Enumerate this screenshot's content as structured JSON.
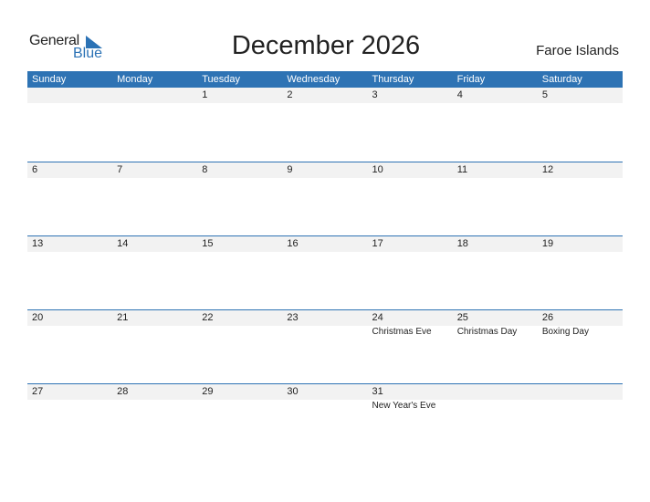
{
  "logo": {
    "general": "General",
    "blue": "Blue"
  },
  "title": "December 2026",
  "country": "Faroe Islands",
  "colors": {
    "accent": "#2e73b4",
    "band": "#f2f2f2"
  },
  "weekdays": [
    "Sunday",
    "Monday",
    "Tuesday",
    "Wednesday",
    "Thursday",
    "Friday",
    "Saturday"
  ],
  "weeks": [
    [
      {
        "day": ""
      },
      {
        "day": ""
      },
      {
        "day": "1"
      },
      {
        "day": "2"
      },
      {
        "day": "3"
      },
      {
        "day": "4"
      },
      {
        "day": "5"
      }
    ],
    [
      {
        "day": "6"
      },
      {
        "day": "7"
      },
      {
        "day": "8"
      },
      {
        "day": "9"
      },
      {
        "day": "10"
      },
      {
        "day": "11"
      },
      {
        "day": "12"
      }
    ],
    [
      {
        "day": "13"
      },
      {
        "day": "14"
      },
      {
        "day": "15"
      },
      {
        "day": "16"
      },
      {
        "day": "17"
      },
      {
        "day": "18"
      },
      {
        "day": "19"
      }
    ],
    [
      {
        "day": "20"
      },
      {
        "day": "21"
      },
      {
        "day": "22"
      },
      {
        "day": "23"
      },
      {
        "day": "24",
        "event": "Christmas Eve"
      },
      {
        "day": "25",
        "event": "Christmas Day"
      },
      {
        "day": "26",
        "event": "Boxing Day"
      }
    ],
    [
      {
        "day": "27"
      },
      {
        "day": "28"
      },
      {
        "day": "29"
      },
      {
        "day": "30"
      },
      {
        "day": "31",
        "event": "New Year's Eve"
      },
      {
        "day": ""
      },
      {
        "day": ""
      }
    ]
  ]
}
